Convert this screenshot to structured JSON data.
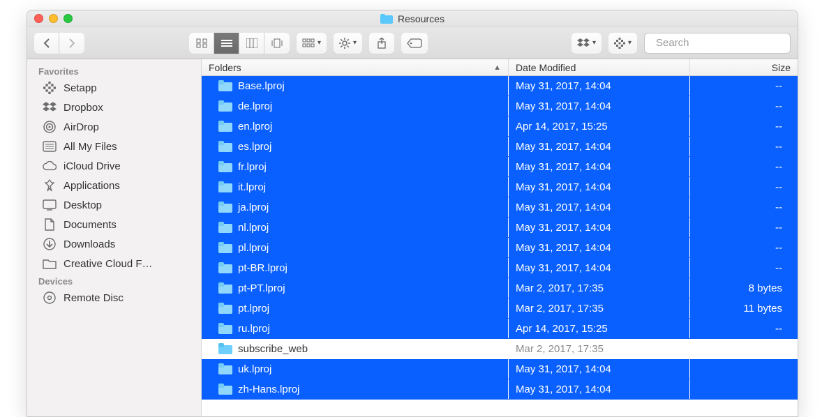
{
  "window": {
    "title": "Resources"
  },
  "toolbar": {
    "search_placeholder": "Search"
  },
  "sidebar": {
    "sections": [
      {
        "label": "Favorites",
        "items": [
          {
            "icon": "setapp",
            "label": "Setapp"
          },
          {
            "icon": "dropbox",
            "label": "Dropbox"
          },
          {
            "icon": "airdrop",
            "label": "AirDrop"
          },
          {
            "icon": "allfiles",
            "label": "All My Files"
          },
          {
            "icon": "cloud",
            "label": "iCloud Drive"
          },
          {
            "icon": "apps",
            "label": "Applications"
          },
          {
            "icon": "desktop",
            "label": "Desktop"
          },
          {
            "icon": "documents",
            "label": "Documents"
          },
          {
            "icon": "downloads",
            "label": "Downloads"
          },
          {
            "icon": "folder",
            "label": "Creative Cloud F…"
          }
        ]
      },
      {
        "label": "Devices",
        "items": [
          {
            "icon": "disc",
            "label": "Remote Disc"
          }
        ]
      }
    ]
  },
  "columns": {
    "name": "Folders",
    "date": "Date Modified",
    "size": "Size"
  },
  "rows": [
    {
      "name": "Base.lproj",
      "date": "May 31, 2017, 14:04",
      "size": "--",
      "selected": true
    },
    {
      "name": "de.lproj",
      "date": "May 31, 2017, 14:04",
      "size": "--",
      "selected": true
    },
    {
      "name": "en.lproj",
      "date": "Apr 14, 2017, 15:25",
      "size": "--",
      "selected": true
    },
    {
      "name": "es.lproj",
      "date": "May 31, 2017, 14:04",
      "size": "--",
      "selected": true
    },
    {
      "name": "fr.lproj",
      "date": "May 31, 2017, 14:04",
      "size": "--",
      "selected": true
    },
    {
      "name": "it.lproj",
      "date": "May 31, 2017, 14:04",
      "size": "--",
      "selected": true
    },
    {
      "name": "ja.lproj",
      "date": "May 31, 2017, 14:04",
      "size": "--",
      "selected": true
    },
    {
      "name": "nl.lproj",
      "date": "May 31, 2017, 14:04",
      "size": "--",
      "selected": true
    },
    {
      "name": "pl.lproj",
      "date": "May 31, 2017, 14:04",
      "size": "--",
      "selected": true
    },
    {
      "name": "pt-BR.lproj",
      "date": "May 31, 2017, 14:04",
      "size": "--",
      "selected": true
    },
    {
      "name": "pt-PT.lproj",
      "date": "Mar 2, 2017, 17:35",
      "size": "8 bytes",
      "selected": true
    },
    {
      "name": "pt.lproj",
      "date": "Mar 2, 2017, 17:35",
      "size": "11 bytes",
      "selected": true
    },
    {
      "name": "ru.lproj",
      "date": "Apr 14, 2017, 15:25",
      "size": "--",
      "selected": true
    },
    {
      "name": "subscribe_web",
      "date": "Mar 2, 2017, 17:35",
      "size": "",
      "selected": false
    },
    {
      "name": "uk.lproj",
      "date": "May 31, 2017, 14:04",
      "size": "",
      "selected": true
    },
    {
      "name": "zh-Hans.lproj",
      "date": "May 31, 2017, 14:04",
      "size": "",
      "selected": true
    }
  ]
}
